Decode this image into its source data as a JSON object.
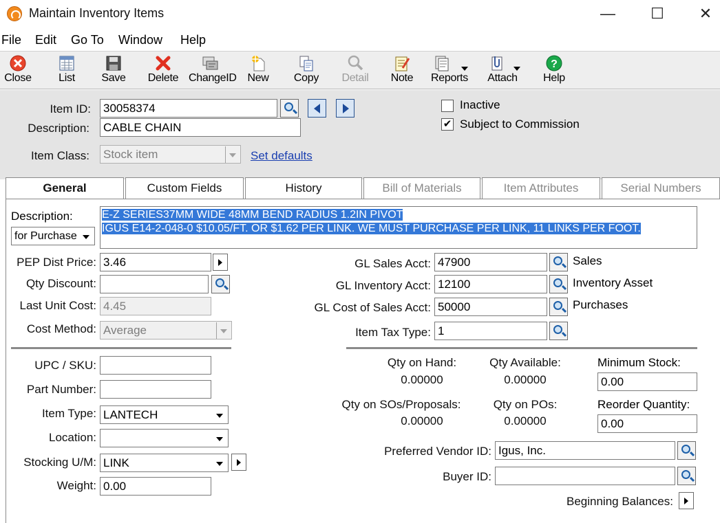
{
  "window": {
    "title": "Maintain Inventory Items",
    "minimize": "—",
    "maximize": "☐",
    "close": "✕"
  },
  "menu": [
    "File",
    "Edit",
    "Go To",
    "Window",
    "Help"
  ],
  "toolbar": [
    {
      "label": "Close",
      "icon": "close-icon"
    },
    {
      "label": "List",
      "icon": "list-icon"
    },
    {
      "label": "Save",
      "icon": "save-icon"
    },
    {
      "label": "Delete",
      "icon": "delete-icon"
    },
    {
      "label": "ChangeID",
      "icon": "changeid-icon"
    },
    {
      "label": "New",
      "icon": "new-icon"
    },
    {
      "label": "Copy",
      "icon": "copy-icon"
    },
    {
      "label": "Detail",
      "icon": "detail-icon",
      "disabled": true
    },
    {
      "label": "Note",
      "icon": "note-icon"
    },
    {
      "label": "Reports",
      "icon": "reports-icon"
    },
    {
      "label": "Attach",
      "icon": "attach-icon"
    },
    {
      "label": "Help",
      "icon": "help-icon"
    }
  ],
  "header": {
    "item_id_label": "Item ID:",
    "item_id": "30058374",
    "description_label": "Description:",
    "description": "CABLE CHAIN",
    "item_class_label": "Item Class:",
    "item_class": "Stock item",
    "set_defaults": "Set defaults",
    "inactive_label": "Inactive",
    "inactive_checked": false,
    "commission_label": "Subject to Commission",
    "commission_checked": true,
    "check_mark": "✔"
  },
  "tabs": [
    {
      "label": "General",
      "active": true
    },
    {
      "label": "Custom Fields"
    },
    {
      "label": "History"
    },
    {
      "label": "Bill of Materials",
      "disabled": true
    },
    {
      "label": "Item Attributes",
      "disabled": true
    },
    {
      "label": "Serial Numbers",
      "disabled": true
    }
  ],
  "general": {
    "description_label": "Description:",
    "description_for": "for Purchase",
    "description_lines": [
      "E-Z SERIES37MM WIDE 48MM BEND RADIUS 1.2IN PIVOT",
      "IGUS E14-2-048-0  $10.05/FT. OR $1.62 PER LINK.  WE MUST PURCHASE PER LINK, 11 LINKS PER FOOT."
    ],
    "pep_dist_price_label": "PEP Dist Price:",
    "pep_dist_price": "3.46",
    "qty_discount_label": "Qty Discount:",
    "qty_discount": "",
    "last_unit_cost_label": "Last Unit Cost:",
    "last_unit_cost": "4.45",
    "cost_method_label": "Cost Method:",
    "cost_method": "Average",
    "gl_sales_label": "GL Sales Acct:",
    "gl_sales": "47900",
    "gl_sales_desc": "Sales",
    "gl_inventory_label": "GL Inventory Acct:",
    "gl_inventory": "12100",
    "gl_inventory_desc": "Inventory Asset",
    "gl_cost_label": "GL Cost of Sales Acct:",
    "gl_cost": "50000",
    "gl_cost_desc": "Purchases",
    "item_tax_label": "Item Tax Type:",
    "item_tax": "1",
    "upc_label": "UPC / SKU:",
    "upc": "",
    "part_number_label": "Part Number:",
    "part_number": "",
    "item_type_label": "Item Type:",
    "item_type": "LANTECH",
    "location_label": "Location:",
    "location": "",
    "stocking_um_label": "Stocking U/M:",
    "stocking_um": "LINK",
    "weight_label": "Weight:",
    "weight": "0.00",
    "qty_on_hand_label": "Qty on Hand:",
    "qty_on_hand": "0.00000",
    "qty_available_label": "Qty Available:",
    "qty_available": "0.00000",
    "minimum_stock_label": "Minimum Stock:",
    "minimum_stock": "0.00",
    "qty_on_sos_label": "Qty on SOs/Proposals:",
    "qty_on_sos": "0.00000",
    "qty_on_pos_label": "Qty on POs:",
    "qty_on_pos": "0.00000",
    "reorder_qty_label": "Reorder Quantity:",
    "reorder_qty": "0.00",
    "preferred_vendor_label": "Preferred Vendor ID:",
    "preferred_vendor": "Igus, Inc.",
    "buyer_id_label": "Buyer ID:",
    "buyer_id": "",
    "beginning_balances_label": "Beginning Balances:"
  }
}
